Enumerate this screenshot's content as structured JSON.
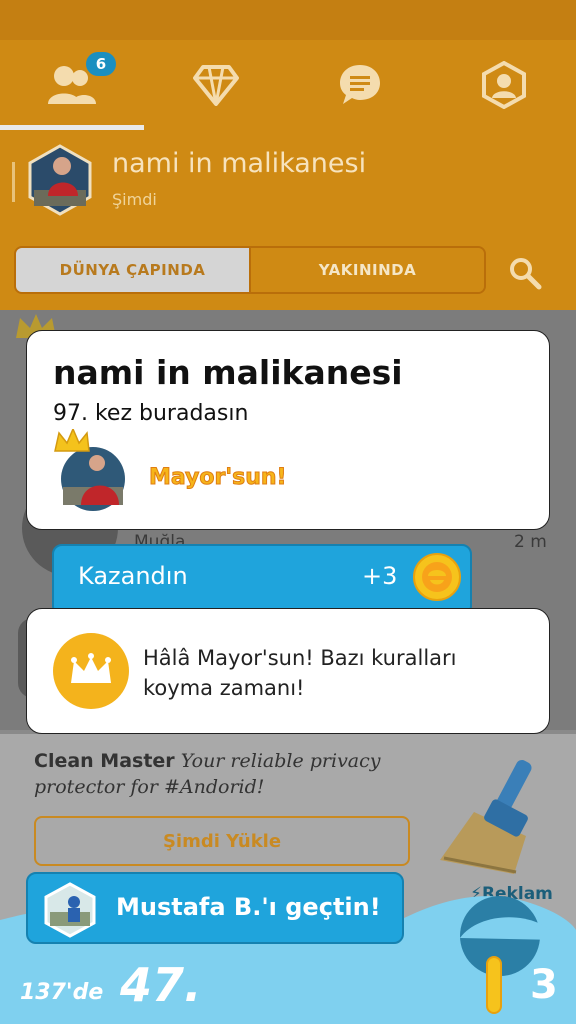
{
  "tabs": {
    "badge_count": "6",
    "items": [
      "friends-tab",
      "badges-tab",
      "messages-tab",
      "profile-tab"
    ]
  },
  "checkin": {
    "title": "nami in malikanesi",
    "time": "Şimdi"
  },
  "filter": {
    "worldwide": "DÜNYA ÇAPINDA",
    "nearby": "YAKININDA"
  },
  "background_list": {
    "location": "Muğla",
    "distance": "2 m"
  },
  "venue_card": {
    "title": "nami in malikanesi",
    "visits": "97. kez buradasın",
    "mayor_label": "Mayor'sun!"
  },
  "reward": {
    "label": "Kazandın",
    "points": "+3"
  },
  "mayor_card": {
    "text": "Hâlâ Mayor'sun! Bazı kuralları koyma zamanı!"
  },
  "ad": {
    "brand": "Clean Master",
    "tagline": "Your reliable privacy protector for #Andorid!",
    "install_label": "Şimdi Yükle",
    "tag": "Reklam"
  },
  "bottom": {
    "passed_text": "Mustafa B.'ı geçtin!",
    "rank_total": "137'de",
    "rank": "47.",
    "coins": "3"
  },
  "colors": {
    "accent_orange": "#cf8a14",
    "accent_blue": "#1fa4dc",
    "gold": "#f4b31c"
  }
}
